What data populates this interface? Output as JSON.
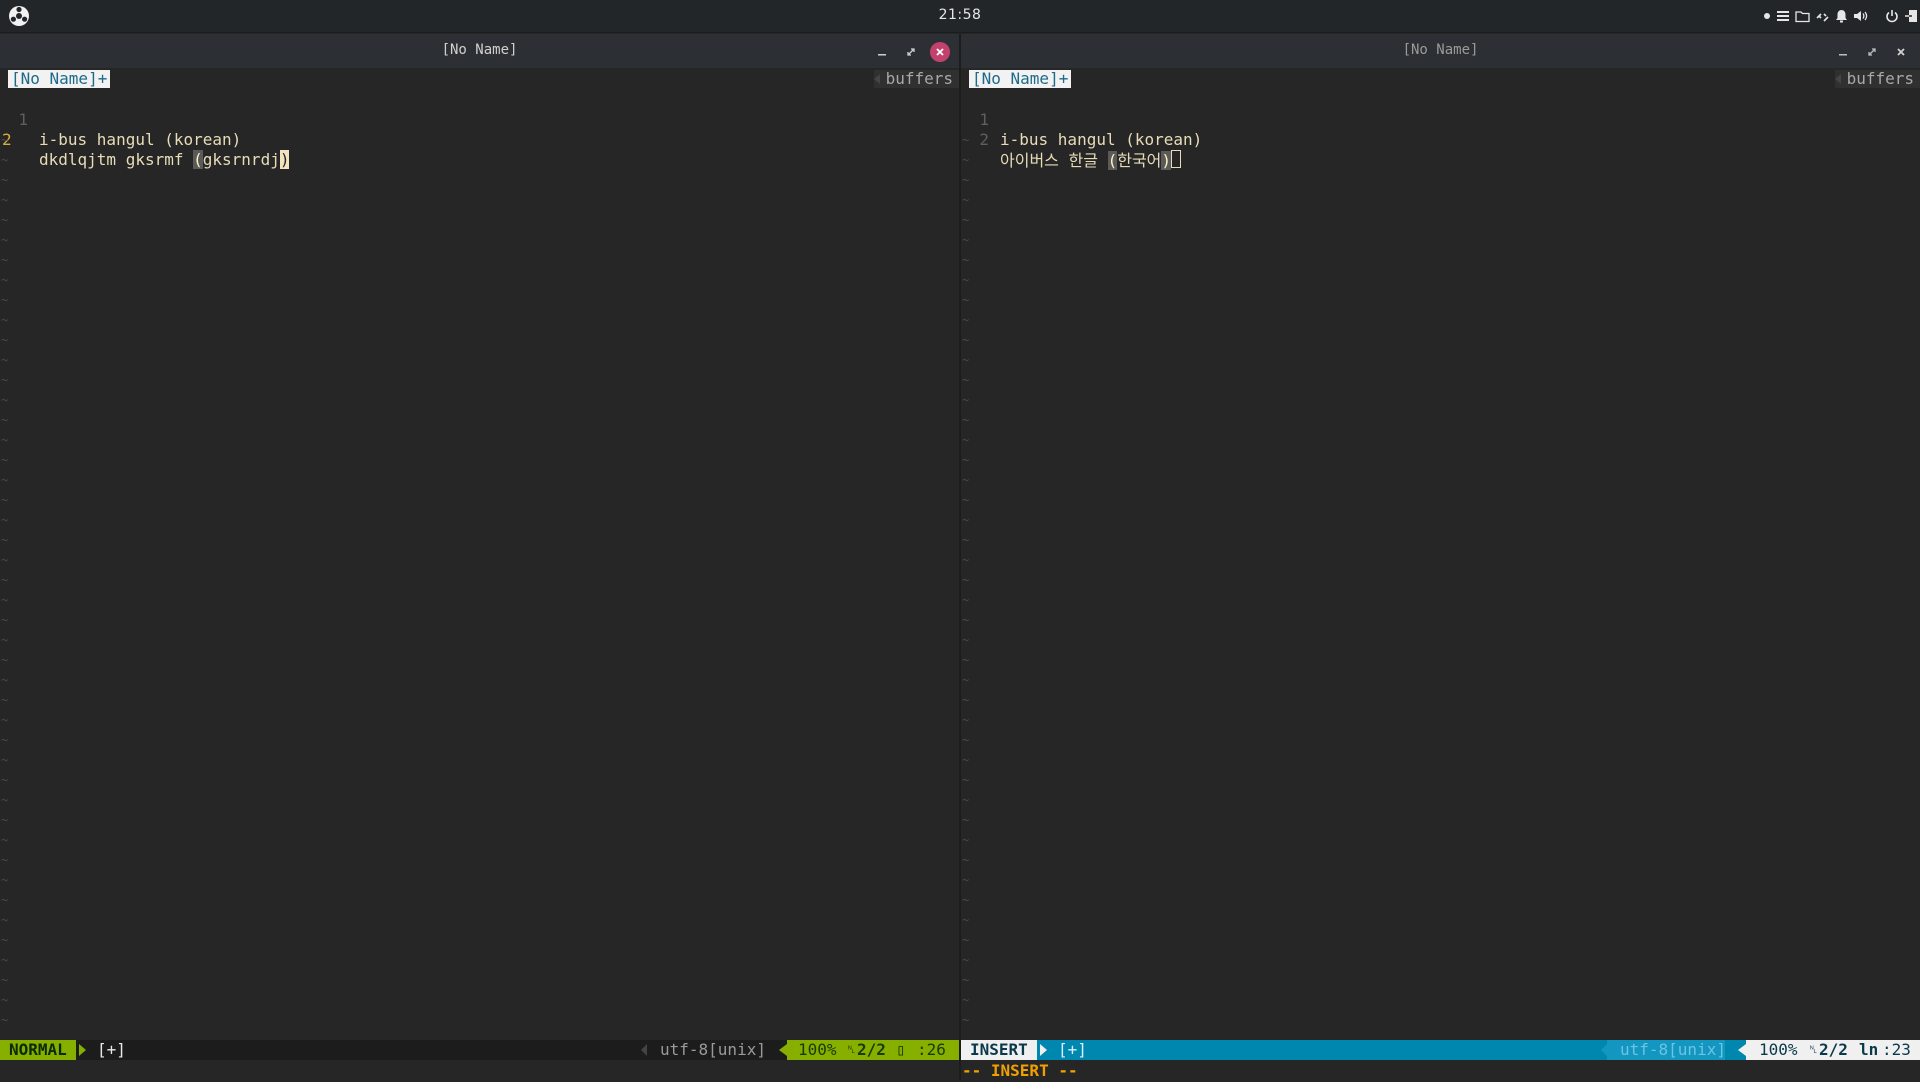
{
  "topbar": {
    "clock": "21:58",
    "tray_icons": [
      "dot-indicator-icon",
      "menu-icon",
      "folder-icon",
      "network-icon",
      "bell-icon",
      "volume-icon",
      "power-icon",
      "logout-icon"
    ]
  },
  "colors": {
    "normal_mode": "#87af00",
    "insert_mode_bar": "#0087af",
    "close_button": "#c2426e",
    "insert_message": "#f0a000"
  },
  "left": {
    "title": "[No Name]",
    "tab": "[No Name]+",
    "buffers": "buffers",
    "lines": [
      {
        "num": "1",
        "text": "i-bus hangul (korean)"
      },
      {
        "num": "2",
        "text_a": "dkdlqjtm gksrmf ",
        "paren": "(",
        "text_b": "gksrnrdj",
        "cursor": ")"
      }
    ],
    "status": {
      "mode": "NORMAL",
      "modified": "[+]",
      "encoding": "utf-8[unix]",
      "percent": "100%",
      "line_glyph": "␤",
      "position": "2/2",
      "col_glyph": "▯",
      "column": ":26"
    }
  },
  "right": {
    "title": "[No Name]",
    "tab": "[No Name]+",
    "buffers": "buffers",
    "lines": [
      {
        "num": "1",
        "text": "i-bus hangul (korean)"
      },
      {
        "num": "2",
        "text_a": "아이버스 한글 ",
        "paren": "(",
        "text_b": "한국어",
        "paren_close": ")"
      }
    ],
    "status": {
      "mode": "INSERT",
      "modified": "[+]",
      "encoding": "utf-8[unix]",
      "percent": "100%",
      "line_glyph": "␤",
      "position": "2/2",
      "ln_label": "ln",
      "column": ":23"
    },
    "cmdline": "-- INSERT --"
  }
}
